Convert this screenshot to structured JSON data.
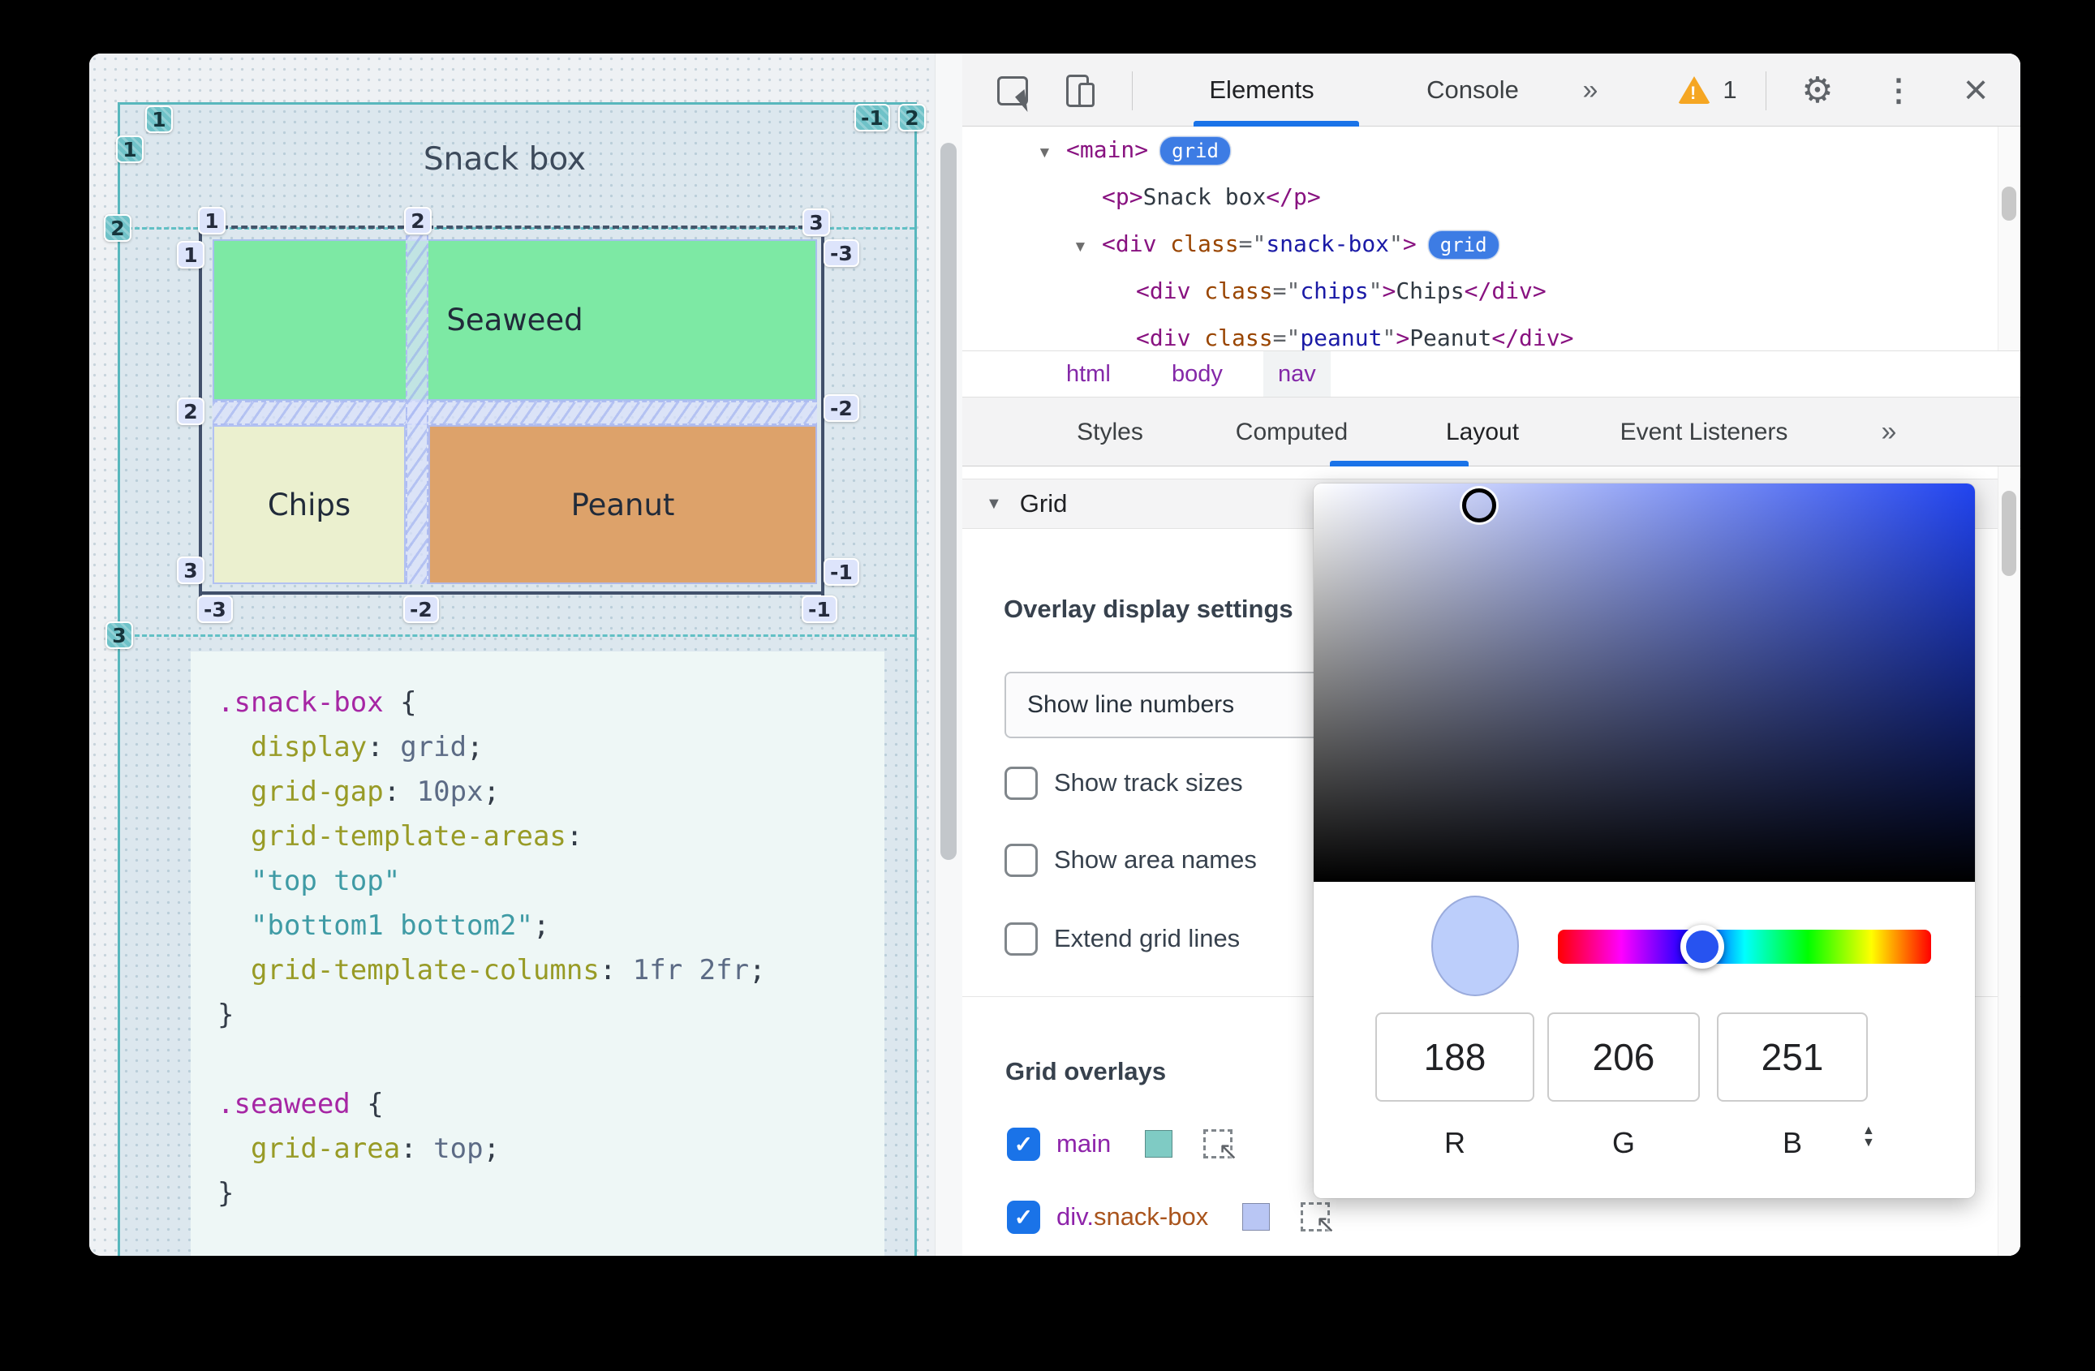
{
  "page": {
    "title": "Snack box",
    "areas": {
      "seaweed": "Seaweed",
      "chips": "Chips",
      "peanut": "Peanut"
    },
    "area_colors": {
      "seaweed": "#7de9a4",
      "chips": "#ebf0cf",
      "peanut": "#dda26a"
    },
    "overlay": {
      "main_badges": {
        "col1": "1",
        "row1": "1",
        "row2": "2",
        "row3": "3",
        "col_neg1": "-1",
        "col2": "2"
      },
      "snack_badges": {
        "col1": "1",
        "col2": "2",
        "col3": "3",
        "row1": "1",
        "row2": "2",
        "row3": "3",
        "right1": "-3",
        "right2": "-2",
        "right3": "-1",
        "bottom1": "-3",
        "bottom2": "-2",
        "bottom3": "-1"
      },
      "colors": {
        "main_line": "#58b7bd",
        "snack_line": "#41506b",
        "main_badge_bg": "#6fc2c8",
        "snack_badge_bg": "#dde4fb"
      }
    },
    "code_lines": [
      [
        [
          "sel",
          ".snack-box"
        ],
        [
          "pun",
          " {"
        ]
      ],
      [
        [
          "pun",
          "  "
        ],
        [
          "prop",
          "display"
        ],
        [
          "pun",
          ": "
        ],
        [
          "val",
          "grid"
        ],
        [
          "pun",
          ";"
        ]
      ],
      [
        [
          "pun",
          "  "
        ],
        [
          "prop",
          "grid-gap"
        ],
        [
          "pun",
          ": "
        ],
        [
          "val",
          "10px"
        ],
        [
          "pun",
          ";"
        ]
      ],
      [
        [
          "pun",
          "  "
        ],
        [
          "prop",
          "grid-template-areas"
        ],
        [
          "pun",
          ":"
        ]
      ],
      [
        [
          "pun",
          "  "
        ],
        [
          "str",
          "\"top top\""
        ]
      ],
      [
        [
          "pun",
          "  "
        ],
        [
          "str",
          "\"bottom1 bottom2\""
        ],
        [
          "pun",
          ";"
        ]
      ],
      [
        [
          "pun",
          "  "
        ],
        [
          "prop",
          "grid-template-columns"
        ],
        [
          "pun",
          ": "
        ],
        [
          "val",
          "1fr 2fr"
        ],
        [
          "pun",
          ";"
        ]
      ],
      [
        [
          "pun",
          "}"
        ]
      ],
      [],
      [
        [
          "sel",
          ".seaweed"
        ],
        [
          "pun",
          " {"
        ]
      ],
      [
        [
          "pun",
          "  "
        ],
        [
          "prop",
          "grid-area"
        ],
        [
          "pun",
          ": "
        ],
        [
          "val",
          "top"
        ],
        [
          "pun",
          ";"
        ]
      ],
      [
        [
          "pun",
          "}"
        ]
      ]
    ]
  },
  "devtools": {
    "toolbar": {
      "tabs": [
        "Elements",
        "Console"
      ],
      "active_tab": "Elements",
      "overflow": "»",
      "warning_count": "1"
    },
    "tree": [
      {
        "indent": 0,
        "arrow": true,
        "badge": "grid",
        "tokens": [
          [
            "tag",
            "<main>"
          ]
        ]
      },
      {
        "indent": 1,
        "arrow": false,
        "tokens": [
          [
            "tag",
            "<p>"
          ],
          [
            "txt",
            "Snack box"
          ],
          [
            "tag",
            "</p>"
          ]
        ]
      },
      {
        "indent": 1,
        "arrow": true,
        "badge": "grid",
        "tokens": [
          [
            "tag",
            "<div"
          ],
          [
            "txt",
            " "
          ],
          [
            "attr",
            "class"
          ],
          [
            "pun",
            "=\""
          ],
          [
            "aval",
            "snack-box"
          ],
          [
            "pun",
            "\""
          ],
          [
            "tag",
            ">"
          ]
        ]
      },
      {
        "indent": 2,
        "arrow": false,
        "tokens": [
          [
            "tag",
            "<div"
          ],
          [
            "txt",
            " "
          ],
          [
            "attr",
            "class"
          ],
          [
            "pun",
            "=\""
          ],
          [
            "aval",
            "chips"
          ],
          [
            "pun",
            "\""
          ],
          [
            "tag",
            ">"
          ],
          [
            "txt",
            "Chips"
          ],
          [
            "tag",
            "</div>"
          ]
        ]
      },
      {
        "indent": 2,
        "arrow": false,
        "clipped": true,
        "tokens": [
          [
            "tag",
            "<div"
          ],
          [
            "txt",
            " "
          ],
          [
            "attr",
            "class"
          ],
          [
            "pun",
            "=\""
          ],
          [
            "aval",
            "peanut"
          ],
          [
            "pun",
            "\""
          ],
          [
            "tag",
            ">"
          ],
          [
            "txt",
            "Peanut"
          ],
          [
            "tag",
            "</div>"
          ]
        ]
      }
    ],
    "breadcrumbs": {
      "items": [
        "html",
        "body",
        "nav"
      ],
      "selected": "nav"
    },
    "panel_tabs": {
      "items": [
        "Styles",
        "Computed",
        "Layout",
        "Event Listeners"
      ],
      "active": "Layout",
      "overflow": "»"
    },
    "layout_panel": {
      "section_label": "Grid",
      "overlay_settings_label": "Overlay display settings",
      "line_numbers_select_value": "Show line numbers",
      "checkboxes": [
        {
          "label": "Show track sizes",
          "checked": false
        },
        {
          "label": "Show area names",
          "checked": false
        },
        {
          "label": "Extend grid lines",
          "checked": false
        }
      ],
      "overlays_label": "Grid overlays",
      "overlays": [
        {
          "element": "main",
          "class": "",
          "swatch": "#7fcbc4",
          "checked": true
        },
        {
          "element": "div",
          "class": "snack-box",
          "swatch": "#b9c6f4",
          "checked": true
        }
      ]
    },
    "color_picker": {
      "r": "188",
      "g": "206",
      "b": "251",
      "labels": [
        "R",
        "G",
        "B"
      ],
      "swatch": "#bccefb",
      "hue_knob_color": "#2753f0"
    }
  }
}
